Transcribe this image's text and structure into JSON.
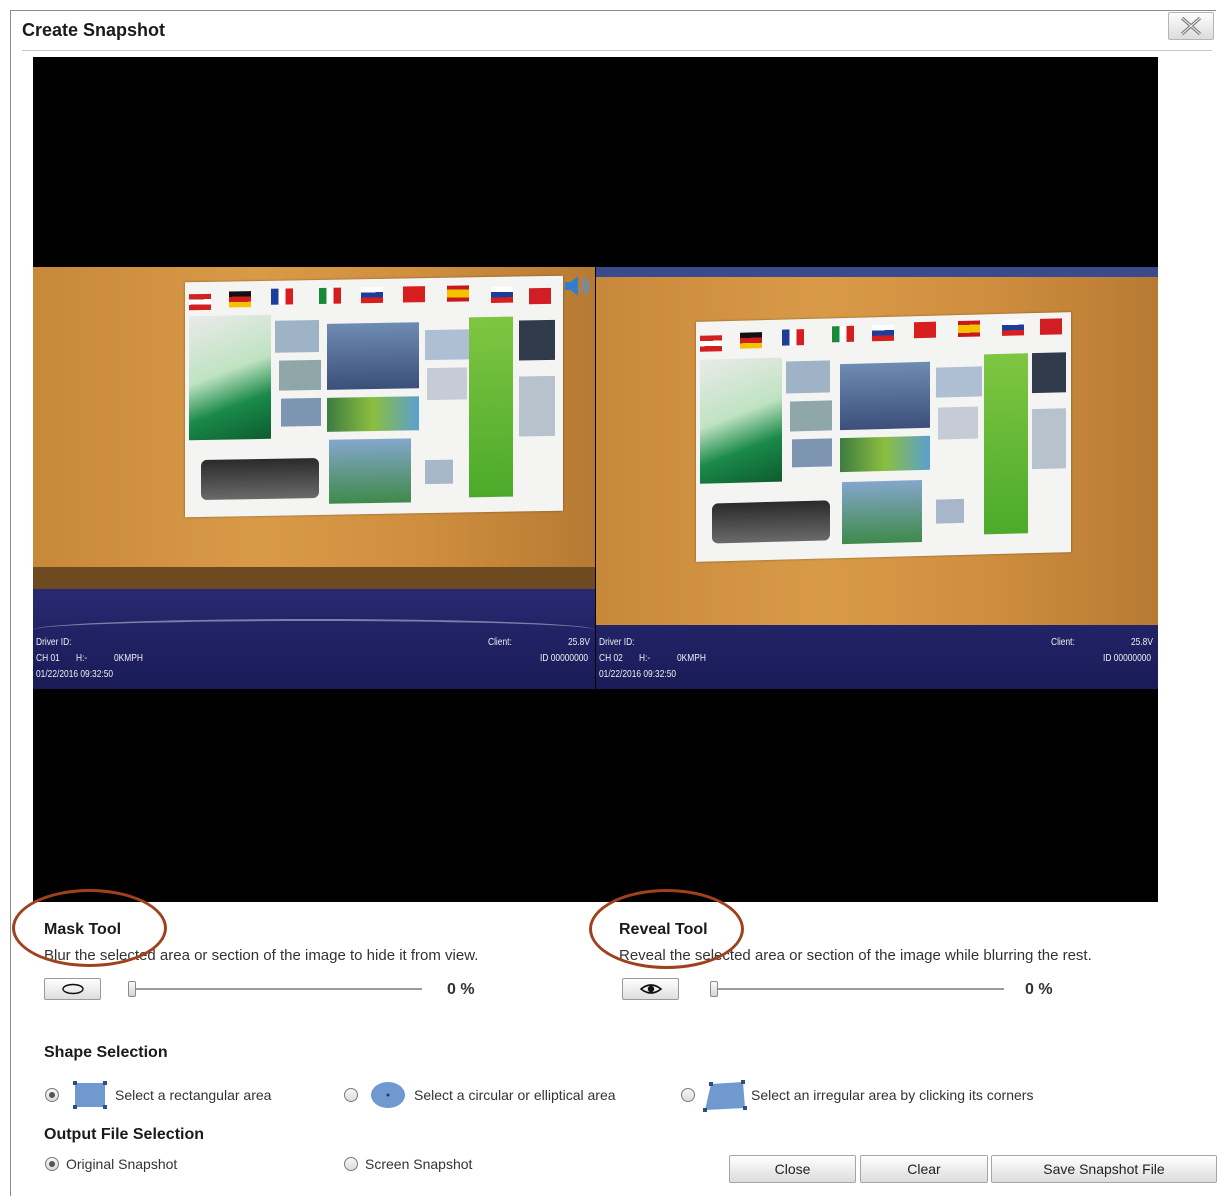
{
  "dialog": {
    "title": "Create Snapshot",
    "close_icon": "close-x-icon"
  },
  "viewer": {
    "left_camera": {
      "osd_driver": "Driver ID:",
      "osd_channel": "CH 01",
      "osd_heading": "H:-",
      "osd_speed": "0KMPH",
      "osd_datetime": "01/22/2016 09:32:50",
      "osd_client": "Client:",
      "osd_voltage": "25.8V",
      "osd_id": "ID 00000000"
    },
    "right_camera": {
      "osd_driver": "Driver ID:",
      "osd_channel": "CH 02",
      "osd_heading": "H:-",
      "osd_speed": "0KMPH",
      "osd_datetime": "01/22/2016 09:32:50",
      "osd_client": "Client:",
      "osd_voltage": "25.8V",
      "osd_id": "ID 00000000"
    },
    "audio_icon": "speaker-icon"
  },
  "mask_tool": {
    "title": "Mask Tool",
    "description": "Blur the selected area or section of the image to hide it from view.",
    "button_icon": "ellipse-icon",
    "value_percent": 0,
    "value_label": "0 %"
  },
  "reveal_tool": {
    "title": "Reveal Tool",
    "description": "Reveal the selected area or section of the image while blurring the rest.",
    "button_icon": "eye-icon",
    "value_percent": 0,
    "value_label": "0 %"
  },
  "shape_selection": {
    "title": "Shape Selection",
    "options": [
      {
        "label": "Select a rectangular area",
        "icon": "rectangle-shape-icon",
        "selected": true
      },
      {
        "label": "Select a circular or elliptical area",
        "icon": "ellipse-shape-icon",
        "selected": false
      },
      {
        "label": "Select an irregular area by clicking its corners",
        "icon": "polygon-shape-icon",
        "selected": false
      }
    ]
  },
  "output_selection": {
    "title": "Output File Selection",
    "options": [
      {
        "label": "Original Snapshot",
        "selected": true
      },
      {
        "label": "Screen Snapshot",
        "selected": false
      }
    ]
  },
  "footer": {
    "close_label": "Close",
    "clear_label": "Clear",
    "save_label": "Save Snapshot File"
  },
  "colors": {
    "annotation_circle": "#a0411e",
    "shape_icon_fill": "#6f99cf",
    "viewer_background": "#000000"
  }
}
